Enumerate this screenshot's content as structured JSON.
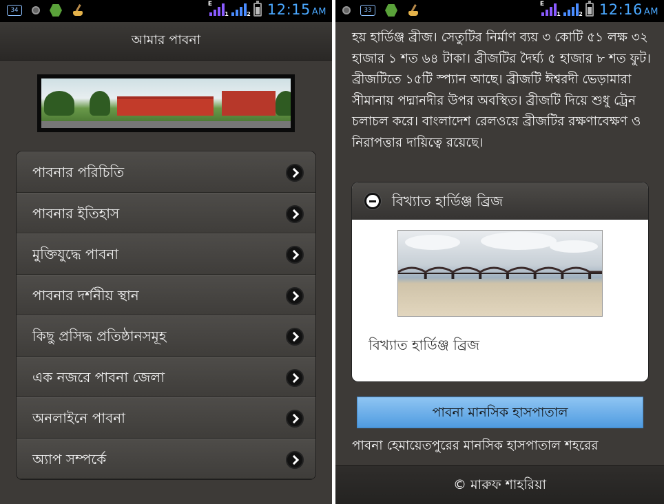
{
  "left_screen": {
    "status_bar": {
      "icons": [
        "sim-34-icon",
        "camera-icon",
        "app-hex-icon",
        "cleaner-icon"
      ],
      "sim_box_label": "34",
      "signal1_label": "E",
      "signal1_sub": "1",
      "signal2_sub": "2",
      "time": "12:15",
      "ampm": "AM"
    },
    "header": {
      "title": "আমার পাবনা"
    },
    "menu": {
      "items": [
        {
          "label": "পাবনার পরিচিতি"
        },
        {
          "label": "পাবনার ইতিহাস"
        },
        {
          "label": "মুক্তিযুদ্ধে পাবনা"
        },
        {
          "label": "পাবনার দর্শনীয় স্থান"
        },
        {
          "label": "কিছু প্রসিদ্ধ প্রতিষ্ঠানসমূহ"
        },
        {
          "label": "এক নজরে পাবনা জেলা"
        },
        {
          "label": "অনলাইনে পাবনা"
        },
        {
          "label": "অ্যাপ সম্পর্কে"
        }
      ]
    }
  },
  "right_screen": {
    "status_bar": {
      "sim_box_label": "33",
      "signal1_label": "E",
      "signal1_sub": "1",
      "signal2_sub": "2",
      "time": "12:16",
      "ampm": "AM"
    },
    "article": {
      "paragraph": "হয় হার্ডিঞ্জ ব্রীজ। সেতুটির নির্মাণ ব্যয় ৩ কোটি ৫১ লক্ষ ৩২ হাজার ১ শত ৬৪ টাকা। ব্রীজটির দৈর্ঘ্য ৫ হাজার ৮ শত ফুট। ব্রীজটিতে ১৫টি স্প্যান আছে। ব্রীজটি ঈশ্বরদী ভেড়ামারা সীমানায় পদ্মানদীর উপর অবস্থিত। ব্রীজটি দিয়ে শুধু ট্রেন চলাচল করে। বাংলাদেশ রেলওয়ে ব্রীজটির রক্ষণাবেক্ষণ ও নিরাপত্তার দায়িত্বে রয়েছে।"
    },
    "collapsible": {
      "title": "বিখ্যাত হার্ডিঞ্জ ব্রিজ",
      "caption": "বিখ্যাত হার্ডিঞ্জ ব্রিজ"
    },
    "section_button": {
      "label": "পাবনা মানসিক হাসপাতাল"
    },
    "article2": {
      "line": "পাবনা হেমায়েতপুরের মানসিক হাসপাতাল শহরের"
    },
    "footer": {
      "text": "© মারুফ শাহরিয়া"
    }
  }
}
